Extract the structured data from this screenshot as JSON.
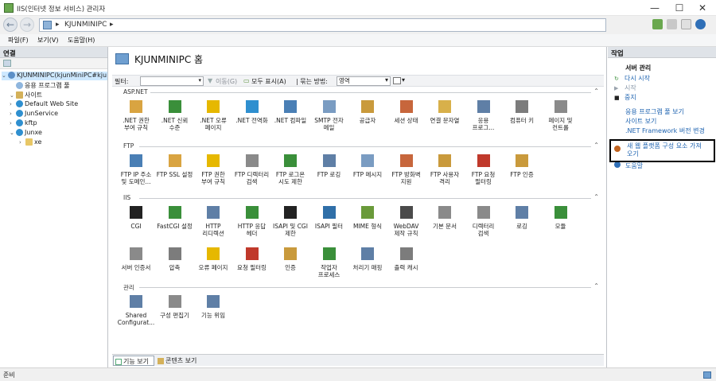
{
  "window": {
    "title": "IIS(인터넷 정보 서비스) 관리자",
    "minimize": "—",
    "maximize": "☐",
    "close": "✕"
  },
  "address": {
    "back": "←",
    "forward": "→",
    "segments": [
      "▸",
      "KJUNMINIPC",
      "▸"
    ]
  },
  "menu": [
    "파일(F)",
    "보기(V)",
    "도움말(H)"
  ],
  "left": {
    "header": "연결",
    "tree": [
      {
        "label": "KJUNMINIPC(kjunMiniPC#kju",
        "icon": "server-icon",
        "color": "#5b8fc7",
        "level": 0,
        "exp": "⌄"
      },
      {
        "label": "응용 프로그램 풀",
        "icon": "app-pool-icon",
        "color": "#8fb6de",
        "level": 1,
        "exp": ""
      },
      {
        "label": "사이트",
        "icon": "sites-folder-icon",
        "color": "#d4b15a",
        "level": 1,
        "exp": "⌄"
      },
      {
        "label": "Default Web Site",
        "icon": "globe-icon",
        "color": "#2f8fcf",
        "level": 2,
        "exp": "›"
      },
      {
        "label": "JunService",
        "icon": "globe-icon",
        "color": "#2f8fcf",
        "level": 2,
        "exp": "›"
      },
      {
        "label": "kftp",
        "icon": "globe-icon",
        "color": "#2f8fcf",
        "level": 2,
        "exp": "›"
      },
      {
        "label": "Junxe",
        "icon": "globe-icon",
        "color": "#2f8fcf",
        "level": 2,
        "exp": "⌄"
      },
      {
        "label": "xe",
        "icon": "folder-icon",
        "color": "#e8c766",
        "level": 3,
        "exp": "›"
      }
    ]
  },
  "main": {
    "title": "KJUNMINIPC 홈",
    "filter": {
      "label": "필터:",
      "go": "이동(G)",
      "show_all": "모두 표시(A)",
      "group_label": "| 묶는 방법:",
      "group_value": "영역"
    },
    "sections": [
      {
        "name": "ASP.NET",
        "items": [
          {
            "label": ".NET 권한\n부여 규칙",
            "icon": "lock-icon",
            "color": "#d9a441"
          },
          {
            "label": ".NET 신뢰\n수준",
            "icon": "trust-check-icon",
            "color": "#3a8f3a"
          },
          {
            "label": ".NET 오류\n페이지",
            "icon": "warning-page-icon",
            "color": "#e6b800"
          },
          {
            "label": ".NET 전역화",
            "icon": "globe-icon",
            "color": "#2f8fcf"
          },
          {
            "label": ".NET 컴파일",
            "icon": "compile-icon",
            "color": "#4a7fb5"
          },
          {
            "label": "SMTP 전자\n메일",
            "icon": "email-icon",
            "color": "#7a9cc2"
          },
          {
            "label": "공급자",
            "icon": "provider-icon",
            "color": "#c99a3c"
          },
          {
            "label": "세션 상태",
            "icon": "session-user-icon",
            "color": "#c7663c"
          },
          {
            "label": "연결 문자열",
            "icon": "connection-string-icon",
            "color": "#d8b04a"
          },
          {
            "label": "응용\n프로그...",
            "icon": "app-settings-icon",
            "color": "#5f7fa6"
          },
          {
            "label": "컴퓨터 키",
            "icon": "machine-key-icon",
            "color": "#7c7c7c"
          },
          {
            "label": "페이지 및\n컨트롤",
            "icon": "pages-controls-icon",
            "color": "#8a8a8a"
          }
        ]
      },
      {
        "name": "FTP",
        "items": [
          {
            "label": "FTP IP 주소\n및 도메인...",
            "icon": "ftp-ip-icon",
            "color": "#4a7fb5"
          },
          {
            "label": "FTP SSL 설정",
            "icon": "ftp-ssl-icon",
            "color": "#d9a441"
          },
          {
            "label": "FTP 권한\n부여 규칙",
            "icon": "ftp-auth-rules-icon",
            "color": "#e6b800"
          },
          {
            "label": "FTP 디렉터리\n검색",
            "icon": "ftp-directory-icon",
            "color": "#8a8a8a"
          },
          {
            "label": "FTP 로그온\n시도 제한",
            "icon": "ftp-logon-icon",
            "color": "#3a8f3a"
          },
          {
            "label": "FTP 로깅",
            "icon": "ftp-logging-icon",
            "color": "#5f7fa6"
          },
          {
            "label": "FTP 메시지",
            "icon": "ftp-message-icon",
            "color": "#7a9cc2"
          },
          {
            "label": "FTP 방화벽\n지원",
            "icon": "ftp-firewall-icon",
            "color": "#c7663c"
          },
          {
            "label": "FTP 사용자\n격리",
            "icon": "ftp-user-isolation-icon",
            "color": "#c99a3c"
          },
          {
            "label": "FTP 요청\n필터링",
            "icon": "ftp-request-filter-icon",
            "color": "#c0392b"
          },
          {
            "label": "FTP 인증",
            "icon": "ftp-authentication-icon",
            "color": "#c99a3c"
          }
        ]
      },
      {
        "name": "IIS",
        "items": [
          {
            "label": "CGI",
            "icon": "cgi-icon",
            "color": "#222222"
          },
          {
            "label": "FastCGI 설정",
            "icon": "fastcgi-icon",
            "color": "#3a8f3a"
          },
          {
            "label": "HTTP\n리디렉션",
            "icon": "http-redirect-icon",
            "color": "#5f7fa6"
          },
          {
            "label": "HTTP 응답\n헤더",
            "icon": "http-headers-icon",
            "color": "#3a8f3a"
          },
          {
            "label": "ISAPI 및 CGI\n제한",
            "icon": "isapi-cgi-icon",
            "color": "#222222"
          },
          {
            "label": "ISAPI 필터",
            "icon": "isapi-filter-icon",
            "color": "#2f6fa8"
          },
          {
            "label": "MIME 형식",
            "icon": "mime-icon",
            "color": "#6a9a3a"
          },
          {
            "label": "WebDAV\n제작 규칙",
            "icon": "webdav-icon",
            "color": "#4a4a4a"
          },
          {
            "label": "기본 문서",
            "icon": "default-document-icon",
            "color": "#8a8a8a"
          },
          {
            "label": "디렉터리\n검색",
            "icon": "directory-browse-icon",
            "color": "#8a8a8a"
          },
          {
            "label": "로깅",
            "icon": "logging-icon",
            "color": "#5f7fa6"
          },
          {
            "label": "모듈",
            "icon": "modules-icon",
            "color": "#3a8f3a"
          },
          {
            "label": "서버 인증서",
            "icon": "certificate-icon",
            "color": "#8a8a8a"
          },
          {
            "label": "압축",
            "icon": "compression-icon",
            "color": "#7c7c7c"
          },
          {
            "label": "오류 페이지",
            "icon": "error-pages-icon",
            "color": "#e6b800"
          },
          {
            "label": "요청 필터링",
            "icon": "request-filter-icon",
            "color": "#c0392b"
          },
          {
            "label": "인증",
            "icon": "authentication-icon",
            "color": "#c99a3c"
          },
          {
            "label": "작업자\n프로세스",
            "icon": "worker-process-icon",
            "color": "#3a8f3a"
          },
          {
            "label": "처리기 매핑",
            "icon": "handler-mapping-icon",
            "color": "#5f7fa6"
          },
          {
            "label": "출력 캐시",
            "icon": "output-cache-icon",
            "color": "#7c7c7c"
          }
        ]
      },
      {
        "name": "관리",
        "items": [
          {
            "label": "Shared\nConfigurat...",
            "icon": "shared-config-icon",
            "color": "#5f7fa6"
          },
          {
            "label": "구성 편집기",
            "icon": "config-editor-icon",
            "color": "#8a8a8a"
          },
          {
            "label": "기능 위임",
            "icon": "feature-delegation-icon",
            "color": "#5f7fa6"
          }
        ]
      }
    ],
    "views": {
      "features": "기능 보기",
      "content": "콘텐츠 보기"
    }
  },
  "right": {
    "header": "작업",
    "group": "서버 관리",
    "actions": [
      {
        "label": "다시 시작",
        "icon": "restart-icon",
        "glyph": "↻",
        "color": "#3a8f3a",
        "enabled": true
      },
      {
        "label": "시작",
        "icon": "start-icon",
        "glyph": "▶",
        "color": "#9aa3ad",
        "enabled": false
      },
      {
        "label": "중지",
        "icon": "stop-icon",
        "glyph": "■",
        "color": "#222222",
        "enabled": true
      }
    ],
    "links": [
      "응용 프로그램 풀 보기",
      "사이트 보기",
      ".NET Framework 버전 변경"
    ],
    "get_components": "새 웹 플랫폼 구성 요소 가져\n오기",
    "help": "도움말"
  },
  "status": {
    "text": "준비"
  }
}
